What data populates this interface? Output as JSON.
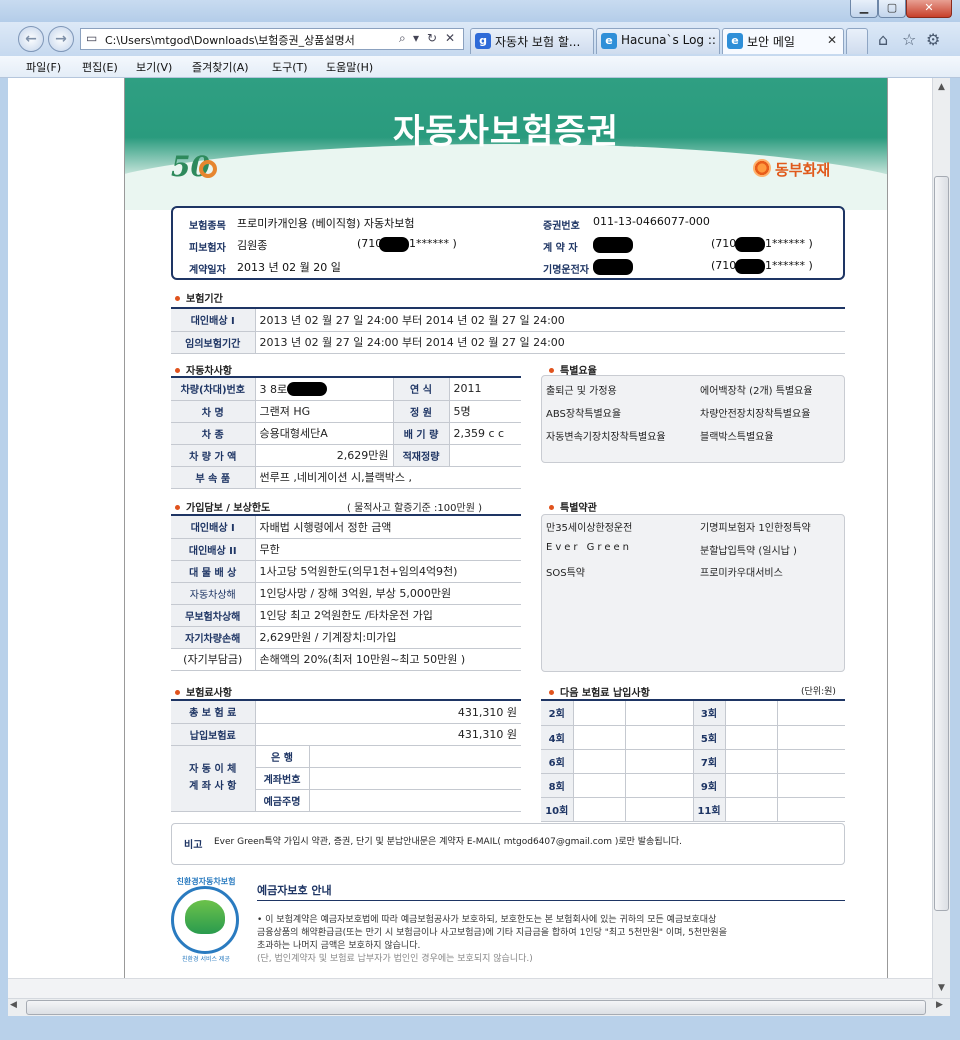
{
  "browser": {
    "address": "C:\\Users\\mtgod\\Downloads\\보험증권_상품설명서",
    "tabs": [
      {
        "label": "자동차 보험 할...",
        "icon": "g",
        "color": "#2f6bd8"
      },
      {
        "label": "Hacuna`s Log :: ...",
        "icon": "e",
        "color": "#2f8fd8"
      },
      {
        "label": "보안 메일",
        "icon": "e",
        "color": "#2f8fd8"
      }
    ],
    "menu": [
      "파일(F)",
      "편집(E)",
      "보기(V)",
      "즐겨찾기(A)",
      "도구(T)",
      "도움말(H)"
    ]
  },
  "doc": {
    "title": "자동차보험증권",
    "anniversary": "50",
    "company": "동부화재",
    "summary": {
      "product_label": "보험종목",
      "product_value": "프로미카개인용 (베이직형) 자동차보험",
      "insured_label": "피보험자",
      "insured_name": "김원종",
      "insured_id": "(710",
      "insured_id_tail": "1******  )",
      "contract_date_label": "계약일자",
      "contract_date": "2013 년 02 월 20 일",
      "policy_no_label": "증권번호",
      "policy_no": "011-13-0466077-000",
      "contractor_label": "계 약 자",
      "contractor_id": "(710",
      "contractor_id_tail": "1******  )",
      "driver_label": "기명운전자",
      "driver_id": "(710",
      "driver_id_tail": "1******  )"
    },
    "period": {
      "title": "보험기간",
      "rows": [
        {
          "label": "대인배상 I",
          "value": "2013 년 02 월 27 일 24:00 부터 2014 년 02 월 27 일 24:00"
        },
        {
          "label": "임의보험기간",
          "value": "2013 년 02 월 27 일 24:00 부터 2014 년 02 월 27 일 24:00"
        }
      ]
    },
    "vehicle": {
      "title": "자동차사항",
      "plate_label": "차량(차대)번호",
      "plate": "3 8로",
      "year_label": "연  식",
      "year": "2011",
      "model_label": "차  명",
      "model": "그랜져  HG",
      "capacity_label": "정  원",
      "capacity": "5명",
      "type_label": "차  종",
      "type": "승용대형세단A",
      "displacement_label": "배 기 량",
      "displacement": "2,359 c c",
      "value_label": "차 량 가 액",
      "value": "2,629만원",
      "load_label": "적재정량",
      "load": "",
      "accessory_label": "부 속 품",
      "accessories": "썬루프           ,네비게이션  시,블랙박스        ,"
    },
    "special_terms": {
      "title": "특별요율",
      "items": [
        "출퇴근  및  가정용",
        "에어백장착  (2개)  특별요율",
        "ABS장착특별요율",
        "차량안전장치장착특별요율",
        "자동변속기장치장착특별요율",
        "블랙박스특별요율"
      ]
    },
    "coverage": {
      "title": "가입담보 / 보상한도",
      "note": "( 물적사고  할증기준 :100만원 )",
      "rows": [
        {
          "label": "대인배상 I",
          "value": "자배법 시행령에서 정한 금액"
        },
        {
          "label": "대인배상 II",
          "value": "무한"
        },
        {
          "label": "대 물 배 상",
          "value": "1사고당  5억원한도(의무1천+임의4억9천)"
        },
        {
          "label": "자동차상해",
          "value": "1인당사망 / 장해     3억원,  부상 5,000만원"
        },
        {
          "label": "무보험차상해",
          "value": " 1인당   최고 2억원한도 /타차운전   가입"
        },
        {
          "label": "자기차량손해",
          "value": "2,629만원 / 기계장치:미가입"
        },
        {
          "label": "(자기부담금)",
          "value": "손해액의 20%(최저 10만원~최고 50만원 )"
        }
      ]
    },
    "special_clauses": {
      "title": "특별약관",
      "items": [
        "만35세이상한정운전",
        "기명피보험자  1인한정특약",
        "Ever  Green",
        "분할납입특약 (일시납  )",
        "SOS특약",
        "프로미카우대서비스"
      ]
    },
    "premium": {
      "title": "보험료사항",
      "total_label": "총 보 험 료",
      "total": "431,310 원",
      "paid_label": "납입보험료",
      "paid": "431,310 원",
      "auto_label": "자 동 이 체\n계 좌 사 항",
      "bank_label": "은  행",
      "account_label": "계좌번호",
      "holder_label": "예금주명"
    },
    "next_payment": {
      "title": "다음 보험료 납입사항",
      "unit": "(단위:원)",
      "left": [
        "2회",
        "4회",
        "6회",
        "8회",
        "10회"
      ],
      "right": [
        "3회",
        "5회",
        "7회",
        "9회",
        "11회"
      ]
    },
    "remarks": {
      "label": "비고",
      "text": "Ever Green특약  가입시  약관, 증권,  단기  및  분납안내문은  계약자 E-MAIL( mtgod6407@gmail.com          )로만  발송됩니다."
    },
    "deposit": {
      "seal_top": "친환경자동차보험",
      "seal_caption": "친환경 서비스 제공",
      "title": "예금자보호 안내",
      "lines": [
        "• 이 보험계약은 예금자보호법에 따라 예금보험공사가 보호하되, 보호한도는 본 보험회사에 있는 귀하의 모든 예금보호대상",
        "  금융상품의 해약환급금(또는 만기 시 보험금이나 사고보험금)에 기타 지급금을 합하여 1인당 \"최고 5천만원\" 이며, 5천만원을",
        "  초과하는 나머지 금액은 보호하지 않습니다."
      ],
      "muted_line": "  (단, 법인계약자 및 보험료 납부자가 법인인 경우에는 보호되지 않습니다.)"
    }
  }
}
